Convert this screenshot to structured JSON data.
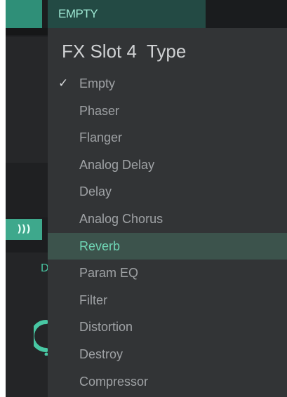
{
  "header": {
    "field_value": "EMPTY"
  },
  "menu": {
    "title": "FX Slot 4  Type",
    "selected_index": 0,
    "highlighted_index": 6,
    "items": [
      {
        "label": "Empty"
      },
      {
        "label": "Phaser"
      },
      {
        "label": "Flanger"
      },
      {
        "label": "Analog Delay"
      },
      {
        "label": "Delay"
      },
      {
        "label": "Analog Chorus"
      },
      {
        "label": "Reverb"
      },
      {
        "label": "Param EQ"
      },
      {
        "label": "Filter"
      },
      {
        "label": "Distortion"
      },
      {
        "label": "Destroy"
      },
      {
        "label": "Compressor"
      }
    ]
  },
  "background": {
    "sound_button_icon": "sound-waves-icon",
    "partial_letter": "D"
  },
  "colors": {
    "accent": "#3ea88c",
    "highlight_text": "#6fd6b5",
    "menu_bg": "#323436"
  }
}
